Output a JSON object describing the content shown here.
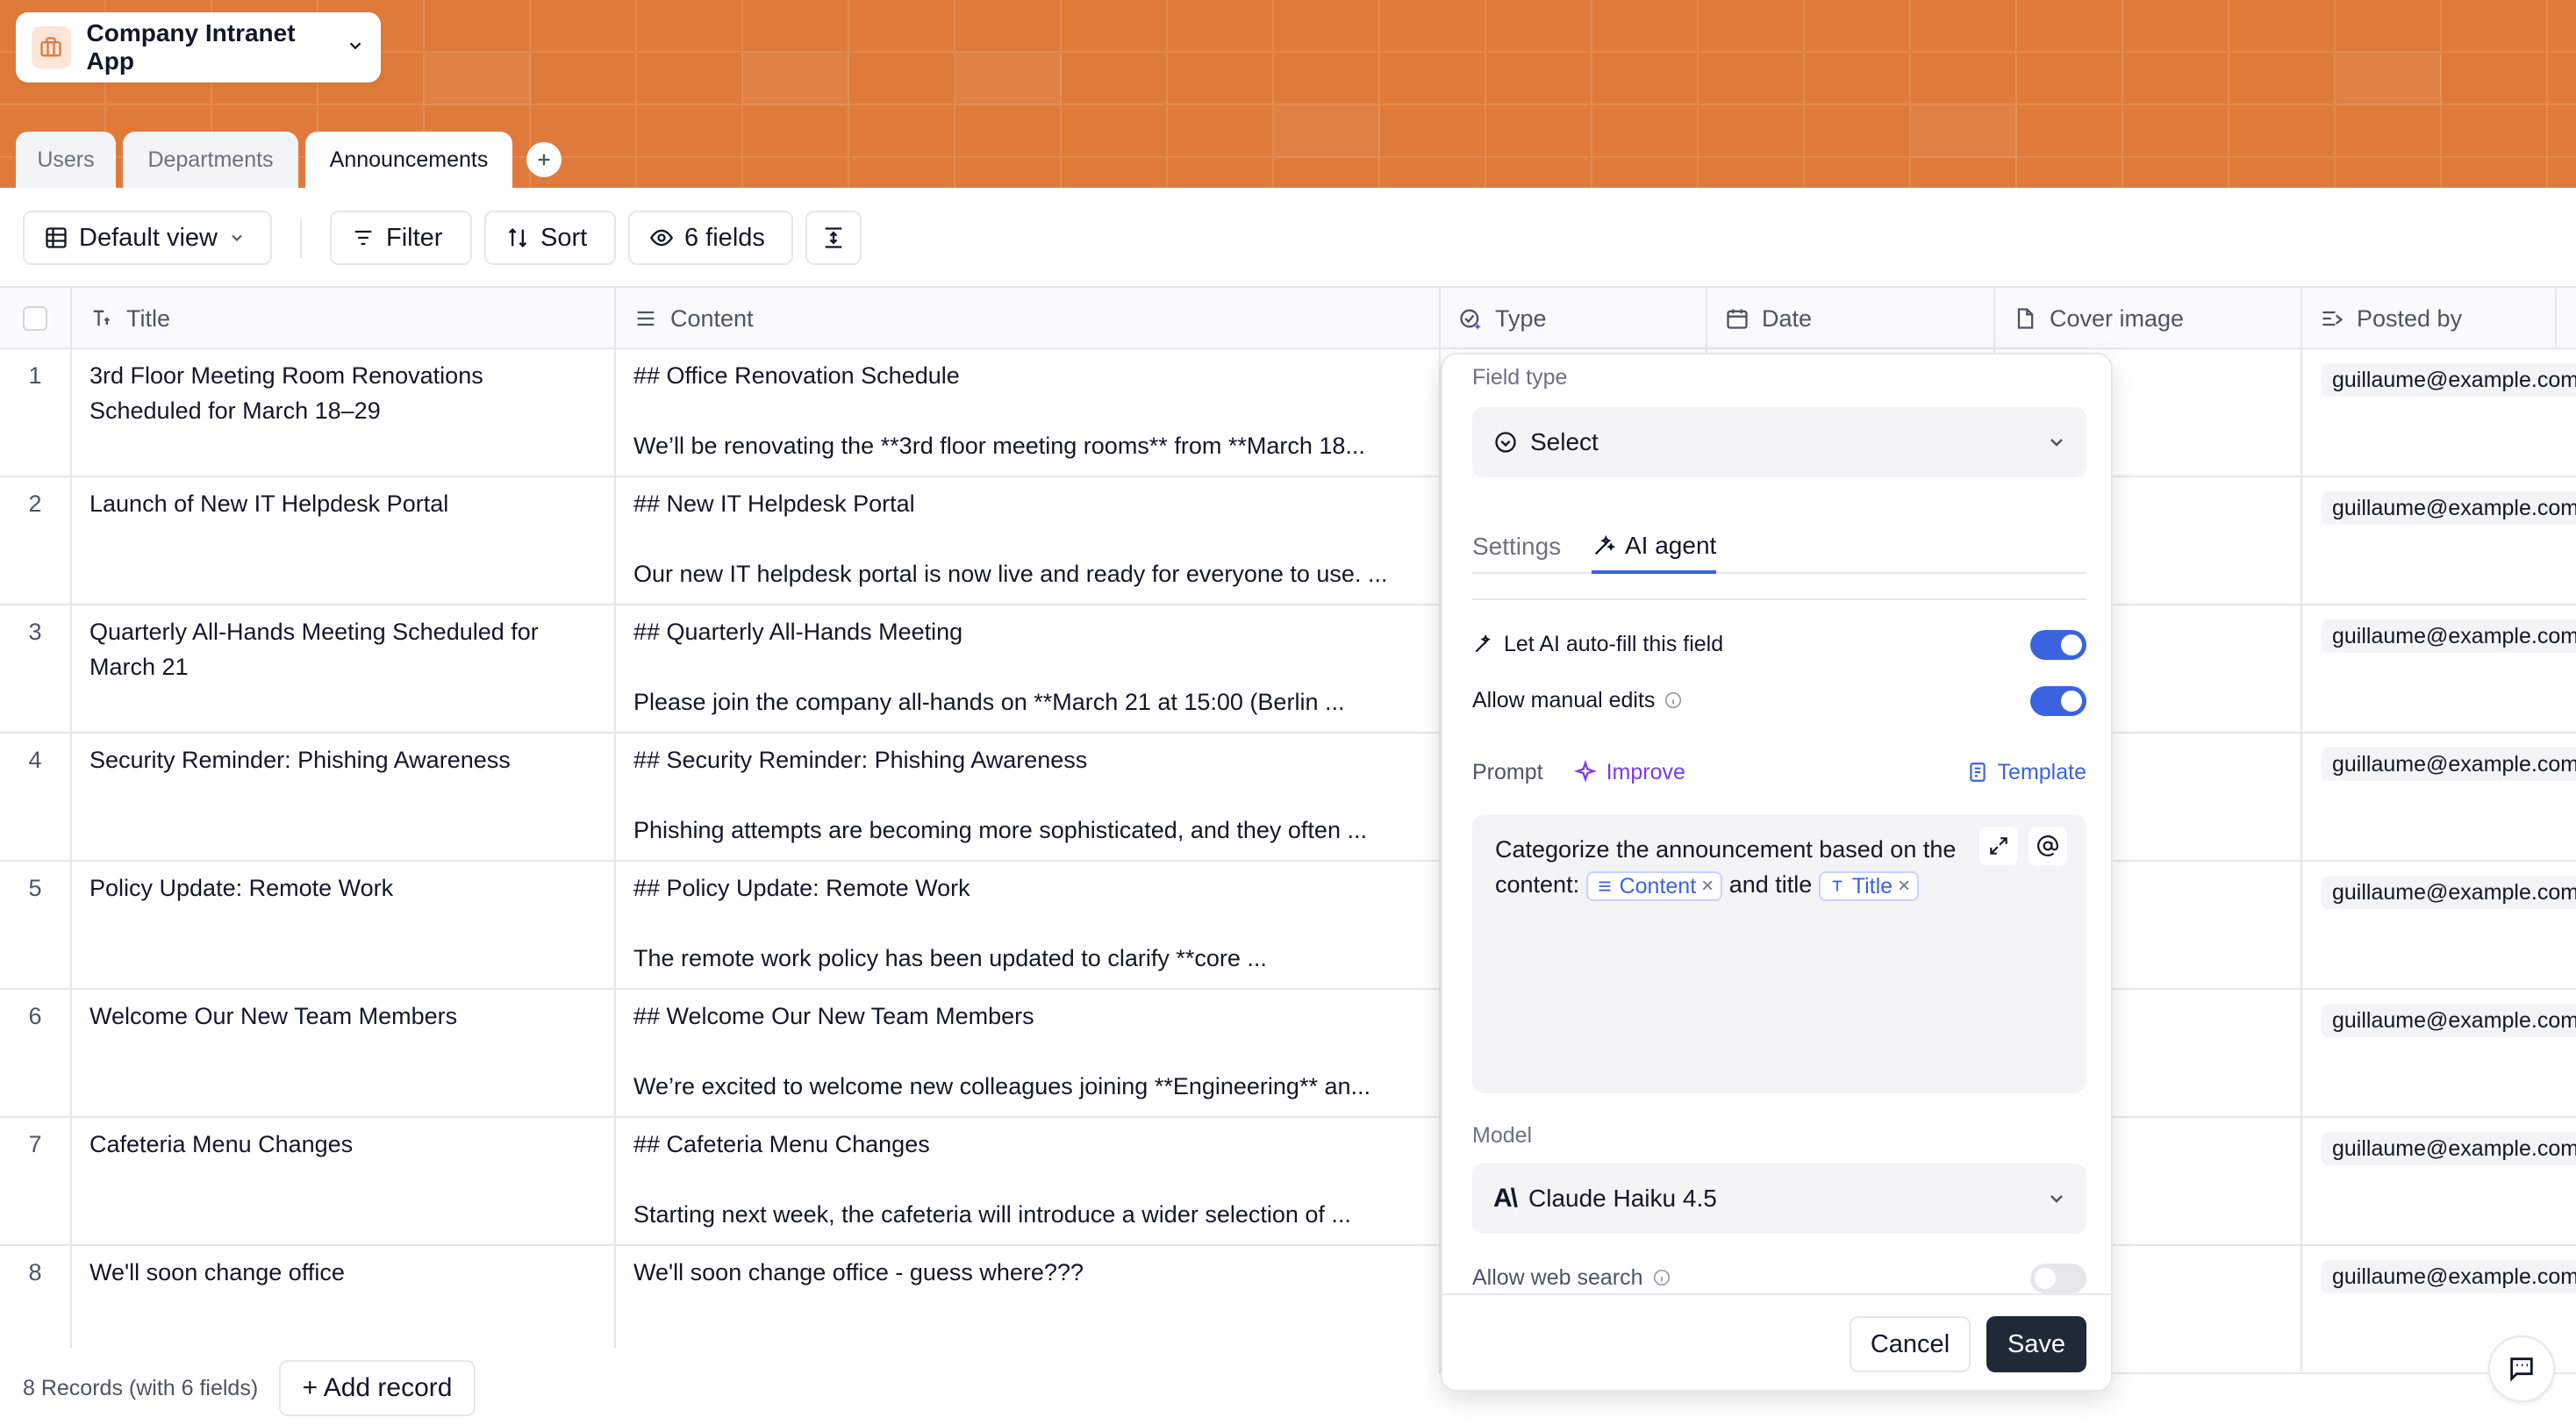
{
  "app": {
    "title": "Company Intranet App"
  },
  "tabs": [
    {
      "label": "Users"
    },
    {
      "label": "Departments"
    },
    {
      "label": "Announcements"
    }
  ],
  "toolbar": {
    "view_label": "Default view",
    "filter_label": "Filter",
    "sort_label": "Sort",
    "fields_label": "6 fields"
  },
  "columns": [
    {
      "label": "Title"
    },
    {
      "label": "Content"
    },
    {
      "label": "Type"
    },
    {
      "label": "Date"
    },
    {
      "label": "Cover image"
    },
    {
      "label": "Posted by"
    }
  ],
  "rows": [
    {
      "num": "1",
      "title": "3rd Floor Meeting Room Renovations Scheduled for March 18–29",
      "content_h": "## Office Renovation Schedule",
      "content_p": "We’ll be renovating the **3rd floor meeting rooms** from **March 18...",
      "posted_by": "guillaume@example.com"
    },
    {
      "num": "2",
      "title": "Launch of New IT Helpdesk Portal",
      "content_h": "## New IT Helpdesk Portal",
      "content_p": "Our new IT helpdesk portal is now live and ready for everyone to use. ...",
      "posted_by": "guillaume@example.com"
    },
    {
      "num": "3",
      "title": "Quarterly All-Hands Meeting Scheduled for March 21",
      "content_h": "## Quarterly All-Hands Meeting",
      "content_p": "Please join the company all-hands on **March 21 at 15:00 (Berlin ...",
      "posted_by": "guillaume@example.com"
    },
    {
      "num": "4",
      "title": "Security Reminder: Phishing Awareness",
      "content_h": "## Security Reminder: Phishing Awareness",
      "content_p": "Phishing attempts are becoming more sophisticated, and they often ...",
      "posted_by": "guillaume@example.com"
    },
    {
      "num": "5",
      "title": "Policy Update: Remote Work",
      "content_h": "## Policy Update: Remote Work",
      "content_p": "The remote work policy has been updated to clarify **core ...",
      "posted_by": "guillaume@example.com"
    },
    {
      "num": "6",
      "title": "Welcome Our New Team Members",
      "content_h": "## Welcome Our New Team Members",
      "content_p": "We’re excited to welcome new colleagues joining **Engineering** an...",
      "posted_by": "guillaume@example.com"
    },
    {
      "num": "7",
      "title": "Cafeteria Menu Changes",
      "content_h": "## Cafeteria Menu Changes",
      "content_p": "Starting next week, the cafeteria will introduce a wider selection of ...",
      "posted_by": "guillaume@example.com"
    },
    {
      "num": "8",
      "title": "We'll soon change office",
      "content_h": "We'll soon change office - guess where???",
      "content_p": "",
      "posted_by": "guillaume@example.com"
    }
  ],
  "footer": {
    "record_count": "8 Records (with 6 fields)",
    "add_record_label": "+ Add record"
  },
  "panel": {
    "field_type_label": "Field type",
    "field_type_value": "Select",
    "tab_settings": "Settings",
    "tab_ai_agent": "AI agent",
    "autofill_label": "Let AI auto-fill this field",
    "autofill_on": true,
    "manual_edits_label": "Allow manual edits",
    "manual_edits_on": true,
    "prompt_label": "Prompt",
    "improve_label": "Improve",
    "template_label": "Template",
    "prompt_text_1": "Categorize the announcement based on the content:",
    "prompt_chip_content": "Content",
    "prompt_text_2": "and title",
    "prompt_chip_title": "Title",
    "model_label": "Model",
    "model_value": "Claude Haiku 4.5",
    "web_search_label": "Allow web search",
    "web_search_on": false,
    "cancel_label": "Cancel",
    "save_label": "Save"
  },
  "colors": {
    "banner": "#e07a3a",
    "accent": "#3b63e0",
    "improve": "#7c3aed",
    "save_button": "#1f2937"
  }
}
